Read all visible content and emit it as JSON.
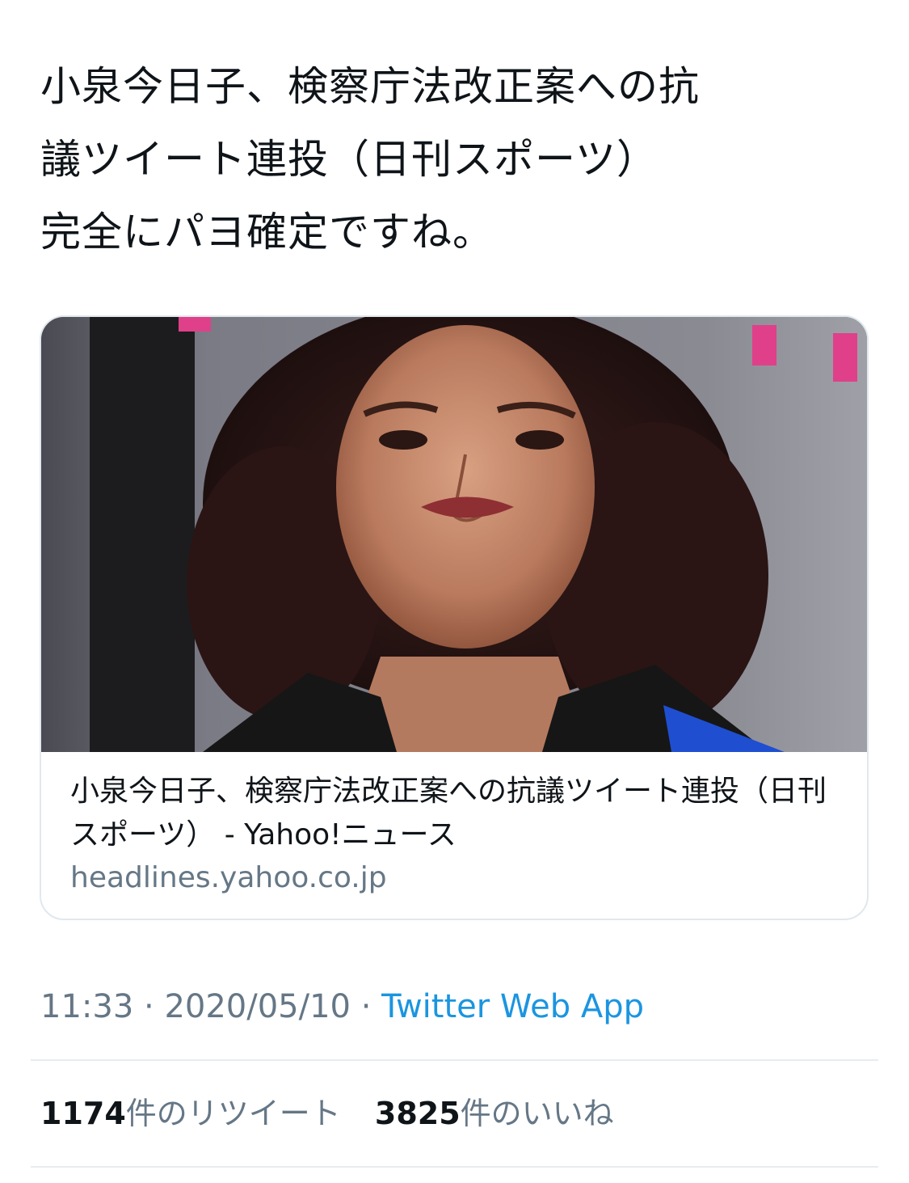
{
  "tweet": {
    "text": "小泉今日子、検察庁法改正案への抗\n議ツイート連投（日刊スポーツ）\n完全にパヨ確定ですね。"
  },
  "card": {
    "image_alt": "woman-portrait-photo",
    "title": "小泉今日子、検察庁法改正案への抗議ツイート連投（日刊スポーツ） - Yahoo!ニュース",
    "domain": "headlines.yahoo.co.jp"
  },
  "meta": {
    "time": "11:33",
    "separator1": " · ",
    "date": "2020/05/10",
    "separator2": " · ",
    "source": "Twitter Web App"
  },
  "stats": {
    "retweets_count": "1174",
    "retweets_label": "件のリツイート",
    "likes_count": "3825",
    "likes_label": "件のいいね"
  },
  "colors": {
    "text": "#0f1419",
    "secondary": "#657786",
    "link": "#1b95e0",
    "border": "#e1e8ed"
  }
}
